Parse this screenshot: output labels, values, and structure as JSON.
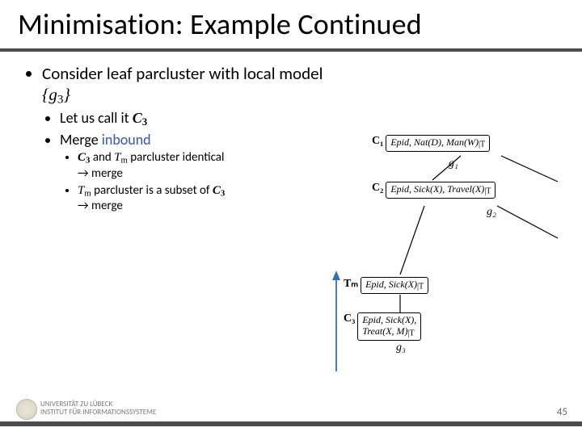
{
  "title": "Minimisation: Example Continued",
  "bullets": {
    "b1_pre": "Consider leaf parcluster with local model ",
    "b1_model_open": "{",
    "b1_model_g": "g",
    "b1_model_sub": "3",
    "b1_model_close": "}",
    "b2_pre": "Let us call it ",
    "b2_sym": "C",
    "b2_sub": "3",
    "b3_pre": "Merge ",
    "b3_inbound": "inbound",
    "b4a_c": "C",
    "b4a_c_sub": "3",
    "b4a_mid": " and ",
    "b4a_t": "T",
    "b4a_t_sub": "m",
    "b4a_post": " parcluster identical",
    "b4a_arrow": "→ merge",
    "b4b_t": "T",
    "b4b_t_sub": "m",
    "b4b_mid": " parcluster is a subset of ",
    "b4b_c": "C",
    "b4b_c_sub": "3",
    "b4b_arrow": "→ merge"
  },
  "nodes": {
    "c1_label": "C₁",
    "c1_box": "Epid, Nat(D), Man(W)",
    "g1": "g₁",
    "c2_label": "C₂",
    "c2_box": "Epid, Sick(X), Travel(X)",
    "g2": "g₂",
    "tm_label": "Tₘ",
    "tm_box": "Epid, Sick(X)",
    "c3_label": "C₃",
    "c3_box_l1": "Epid, Sick(X),",
    "c3_box_l2": "Treat(X, M)",
    "g3": "g₃",
    "pipe_t": "|T"
  },
  "footer": {
    "line1": "UNIVERSITÄT ZU LÜBECK",
    "line2": "INSTITUT FÜR INFORMATIONSSYSTEME",
    "page": "45"
  }
}
